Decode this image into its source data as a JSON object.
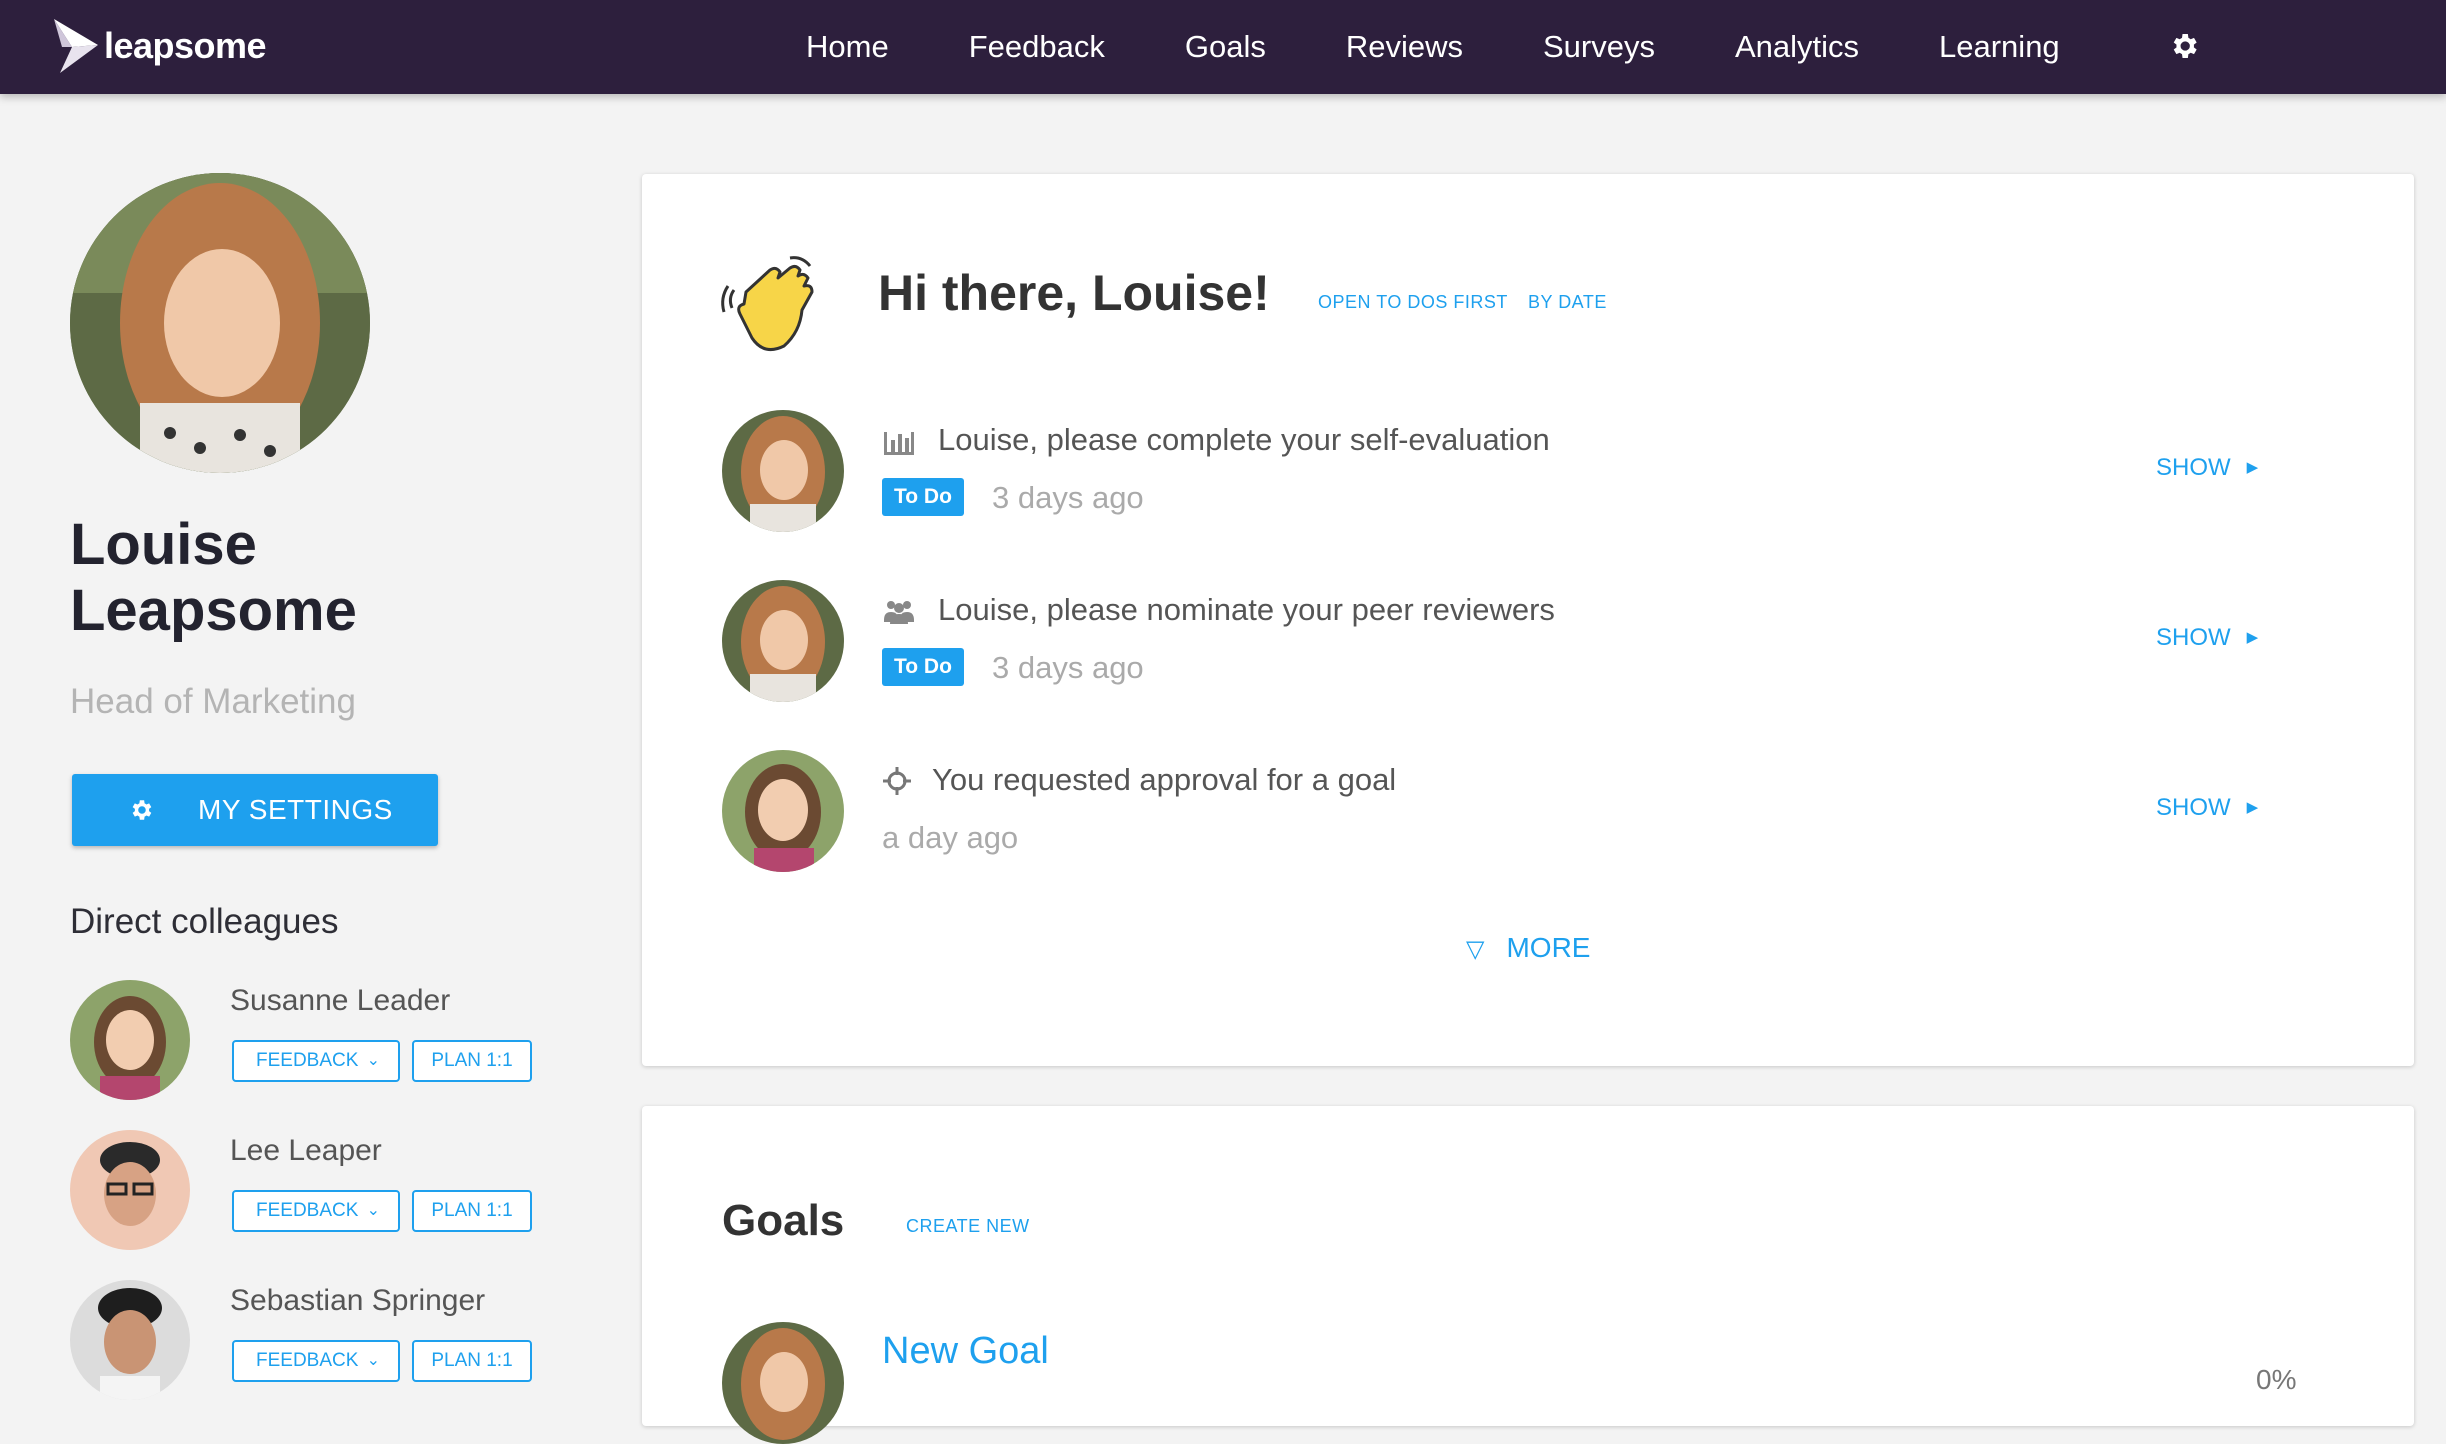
{
  "app": {
    "brand": "leapsome"
  },
  "nav": {
    "items": [
      "Home",
      "Feedback",
      "Goals",
      "Reviews",
      "Surveys",
      "Analytics",
      "Learning"
    ],
    "settings_icon": "gear-icon"
  },
  "profile": {
    "name": "Louise Leapsome",
    "title": "Head of Marketing",
    "settings_label": "MY SETTINGS"
  },
  "colleagues": {
    "title": "Direct colleagues",
    "feedback_label": "FEEDBACK",
    "plan_label": "PLAN 1:1",
    "items": [
      {
        "name": "Susanne Leader"
      },
      {
        "name": "Lee Leaper"
      },
      {
        "name": "Sebastian Springer"
      }
    ]
  },
  "todos": {
    "greeting": "Hi there, Louise!",
    "sort_open": "OPEN TO DOS FIRST",
    "sort_date": "BY DATE",
    "show_label": "SHOW",
    "more_label": "MORE",
    "items": [
      {
        "icon": "bar-chart-icon",
        "text": "Louise, please complete your self-evaluation",
        "badge": "To Do",
        "time": "3 days ago"
      },
      {
        "icon": "people-icon",
        "text": "Louise, please nominate your peer reviewers",
        "badge": "To Do",
        "time": "3 days ago"
      },
      {
        "icon": "crosshair-icon",
        "text": "You requested approval for a goal",
        "badge": "",
        "time": "a day ago"
      }
    ]
  },
  "goals": {
    "title": "Goals",
    "create_label": "CREATE NEW",
    "items": [
      {
        "name": "New Goal",
        "progress": "0%"
      }
    ]
  },
  "colors": {
    "nav_bg": "#2d1f3d",
    "accent": "#1ea0ee",
    "page_bg": "#f3f3f3"
  }
}
